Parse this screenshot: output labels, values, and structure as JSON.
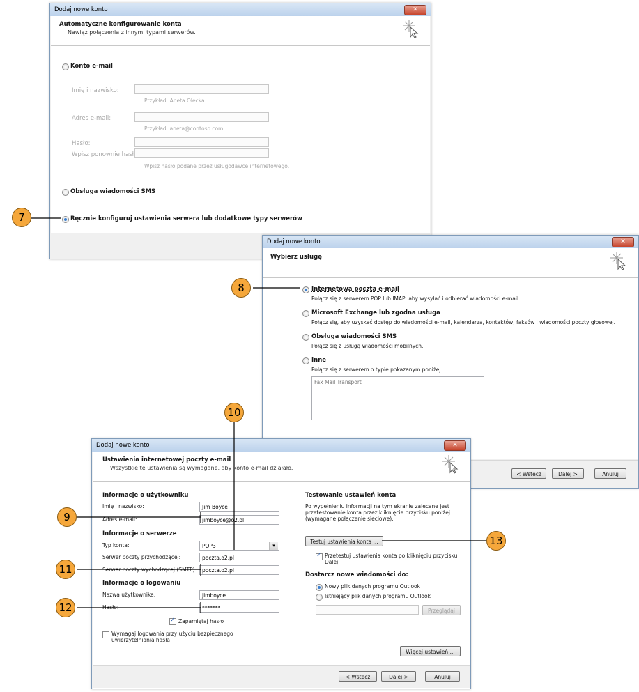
{
  "dialog1": {
    "title": "Dodaj nowe konto",
    "header_title": "Automatyczne konfigurowanie konta",
    "header_subtitle": "Nawiąż połączenia z innymi typami serwerów.",
    "opt_email": "Konto e-mail",
    "label_name": "Imię i nazwisko:",
    "hint_name": "Przykład: Aneta Olecka",
    "label_email": "Adres e-mail:",
    "hint_email": "Przykład: aneta@contoso.com",
    "label_pass": "Hasło:",
    "label_repass": "Wpisz ponownie hasło:",
    "hint_pass": "Wpisz hasło podane przez usługodawcę internetowego.",
    "opt_sms": "Obsługa wiadomości SMS",
    "opt_manual": "Ręcznie konfiguruj ustawienia serwera lub dodatkowe typy serwerów"
  },
  "dialog2": {
    "title": "Dodaj nowe konto",
    "header_title": "Wybierz usługę",
    "opt_internet": "Internetowa poczta e-mail",
    "opt_internet_desc": "Połącz się z serwerem POP lub IMAP, aby wysyłać i odbierać wiadomości e-mail.",
    "opt_exchange": "Microsoft Exchange lub zgodna usługa",
    "opt_exchange_desc": "Połącz się, aby uzyskać dostęp do wiadomości e-mail, kalendarza, kontaktów, faksów i wiadomości poczty głosowej.",
    "opt_sms": "Obsługa wiadomości SMS",
    "opt_sms_desc": "Połącz się z usługą wiadomości mobilnych.",
    "opt_other": "Inne",
    "opt_other_desc": "Połącz się z serwerem o typie pokazanym poniżej.",
    "other_list_item": "Fax Mail Transport",
    "btn_back": "< Wstecz",
    "btn_next": "Dalej >",
    "btn_cancel": "Anuluj"
  },
  "dialog3": {
    "title": "Dodaj nowe konto",
    "header_title": "Ustawienia internetowej poczty e-mail",
    "header_subtitle": "Wszystkie te ustawienia są wymagane, aby konto e-mail działało.",
    "sec_user": "Informacje o użytkowniku",
    "label_name": "Imię i nazwisko:",
    "value_name": "Jim Boyce",
    "label_email": "Adres e-mail:",
    "value_email": "jimboyce@o2.pl",
    "sec_server": "Informacje o serwerze",
    "label_type": "Typ konta:",
    "value_type": "POP3",
    "label_incoming": "Serwer poczty przychodzącej:",
    "value_incoming": "poczta.o2.pl",
    "label_outgoing": "Serwer poczty wychodzącej (SMTP):",
    "value_outgoing": "poczta.o2.pl",
    "sec_login": "Informacje o logowaniu",
    "label_username": "Nazwa użytkownika:",
    "value_username": "jimboyce",
    "label_password": "Hasło:",
    "value_password": "*******",
    "remember": "Zapamiętaj hasło",
    "spa": "Wymagaj logowania przy użyciu bezpiecznego uwierzytelniania hasła",
    "sec_test": "Testowanie ustawień konta",
    "test_desc": "Po wypełnieniu informacji na tym ekranie zalecane jest przetestowanie konta przez kliknięcie przycisku poniżej (wymagane połączenie sieciowe).",
    "btn_test": "Testuj ustawienia konta ...",
    "test_after": "Przetestuj ustawienia konta po kliknięciu przycisku Dalej",
    "sec_deliver": "Dostarcz nowe wiadomości do:",
    "opt_new_file": "Nowy plik danych programu Outlook",
    "opt_existing": "Istniejący plik danych programu Outlook",
    "btn_browse": "Przeglądaj",
    "btn_more": "Więcej ustawień ...",
    "btn_back": "< Wstecz",
    "btn_next": "Dalej >",
    "btn_cancel": "Anuluj"
  },
  "callouts": [
    "7",
    "8",
    "9",
    "10",
    "11",
    "12",
    "13"
  ]
}
